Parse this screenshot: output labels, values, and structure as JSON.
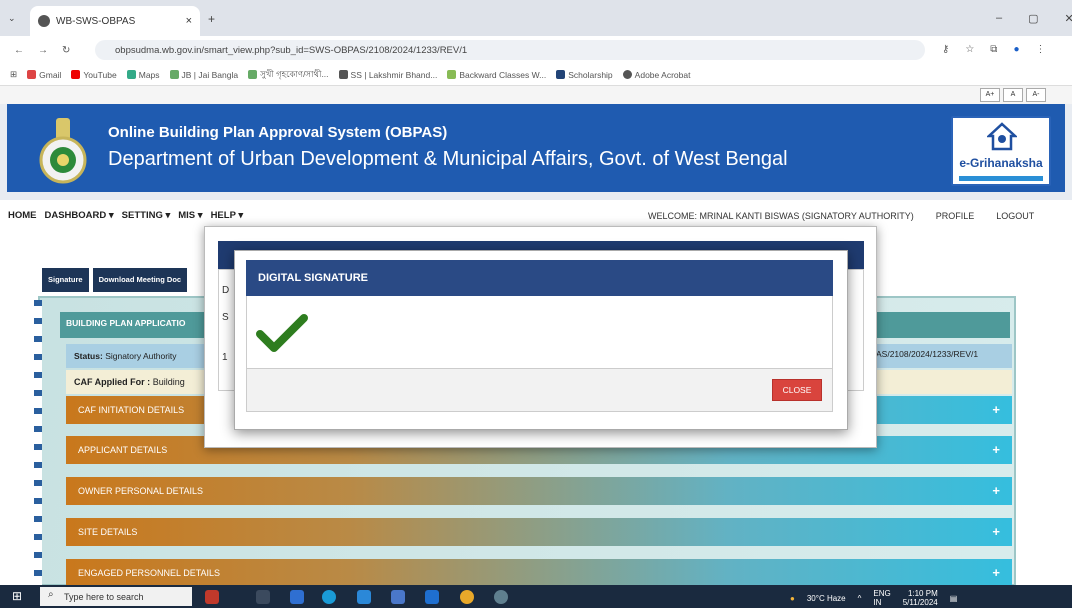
{
  "browser": {
    "tab_title": "WB-SWS-OBPAS",
    "tab_close": "×",
    "new_tab": "+",
    "url": "obpsudma.wb.gov.in/smart_view.php?sub_id=SWS-OBPAS/2108/2024/1233/REV/1",
    "window_controls": [
      "–",
      "▢",
      "✕"
    ],
    "bookmarks": [
      "Gmail",
      "YouTube",
      "Maps",
      "JB | Jai Bangla",
      "সুখী গৃহকোণ/সাথী...",
      "SS | Lakshmir Bhand...",
      "Backward Classes W...",
      "Scholarship",
      "Adobe Acrobat"
    ]
  },
  "font_size_buttons": [
    "A+",
    "A",
    "A-"
  ],
  "header": {
    "title": "Online Building Plan Approval System (OBPAS)",
    "subtitle": "Department of Urban Development & Municipal Affairs, Govt. of West Bengal",
    "logo_text": "e-Grihanaksha"
  },
  "nav": {
    "items": [
      "HOME",
      "DASHBOARD ▾",
      "SETTING ▾",
      "MIS ▾",
      "HELP ▾"
    ],
    "welcome": "WELCOME: MRINAL KANTI BISWAS (SIGNATORY AUTHORITY)",
    "profile": "PROFILE",
    "logout": "LOGOUT"
  },
  "tabs": [
    "Signature",
    "Download Meeting Doc"
  ],
  "panel": {
    "heading": "BUILDING PLAN APPLICATIO",
    "status_label": "Status:",
    "status_value": "Signatory Authority",
    "application_no": "AS/2108/2024/1233/REV/1",
    "caf_label": "CAF Applied For :",
    "caf_value": "Building",
    "sections": [
      "CAF INITIATION DETAILS",
      "APPLICANT DETAILS",
      "OWNER PERSONAL DETAILS",
      "SITE DETAILS",
      "ENGAGED PERSONNEL DETAILS"
    ]
  },
  "outer_dialog": {
    "row1": "D",
    "row2": "S",
    "row3": "1"
  },
  "dialog": {
    "title": "DIGITAL SIGNATURE",
    "close_label": "CLOSE",
    "success_color": "#2e7d1f"
  },
  "taskbar": {
    "search_placeholder": "Type here to search",
    "weather": "30°C Haze",
    "lang1": "ENG",
    "lang2": "IN",
    "time": "1:10 PM",
    "date": "5/11/2024"
  }
}
